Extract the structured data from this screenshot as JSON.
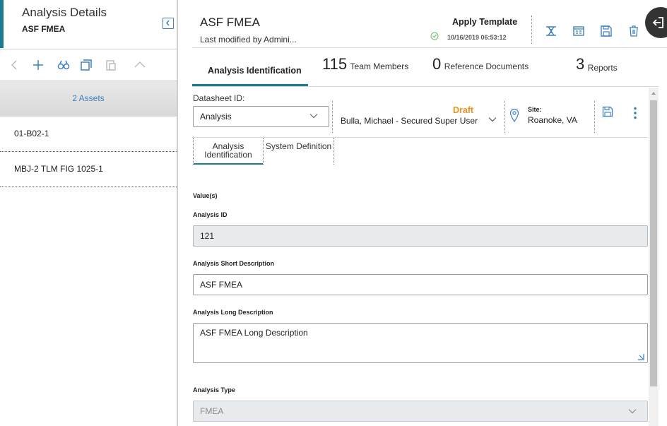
{
  "left_panel": {
    "title": "Analysis Details",
    "subtitle": "ASF FMEA",
    "assets_header": "2 Assets",
    "assets": [
      "01-B02-1",
      "MBJ-2 TLM FIG 1025-1"
    ],
    "toolbar_icons": [
      "back-icon",
      "add-icon",
      "binoculars-icon",
      "copy-icon",
      "paste-icon",
      "collapse-up-icon"
    ]
  },
  "header": {
    "title": "ASF FMEA",
    "modified": "Last modified by Admini...",
    "apply_template": "Apply Template",
    "modified_time": "10/16/2019 06:53:12",
    "icons": [
      "rcm-icon",
      "report-icon",
      "save-icon",
      "delete-icon"
    ]
  },
  "tabs": [
    {
      "label": "Analysis Identification",
      "count": ""
    },
    {
      "label": "Team Members",
      "count": "115"
    },
    {
      "label": "Reference Documents",
      "count": "0"
    },
    {
      "label": "Reports",
      "count": "3"
    }
  ],
  "datasheet": {
    "label": "Datasheet ID:",
    "selected": "Analysis",
    "status": "Draft",
    "owner": "Bulla, Michael - Secured Super User",
    "site_label": "Site:",
    "site_value": "Roanoke, VA"
  },
  "subtabs": [
    "Analysis Identification",
    "System Definition"
  ],
  "form": {
    "section": "Value(s)",
    "analysis_id_label": "Analysis ID",
    "analysis_id": "121",
    "short_desc_label": "Analysis Short Description",
    "short_desc": "ASF FMEA",
    "long_desc_label": "Analysis Long Description",
    "long_desc": "ASF FMEA Long Description",
    "type_label": "Analysis Type",
    "type_value": "FMEA"
  },
  "colors": {
    "accent": "#1b7b91",
    "link_blue": "#3d7fc1",
    "draft_orange": "#f0901b"
  }
}
